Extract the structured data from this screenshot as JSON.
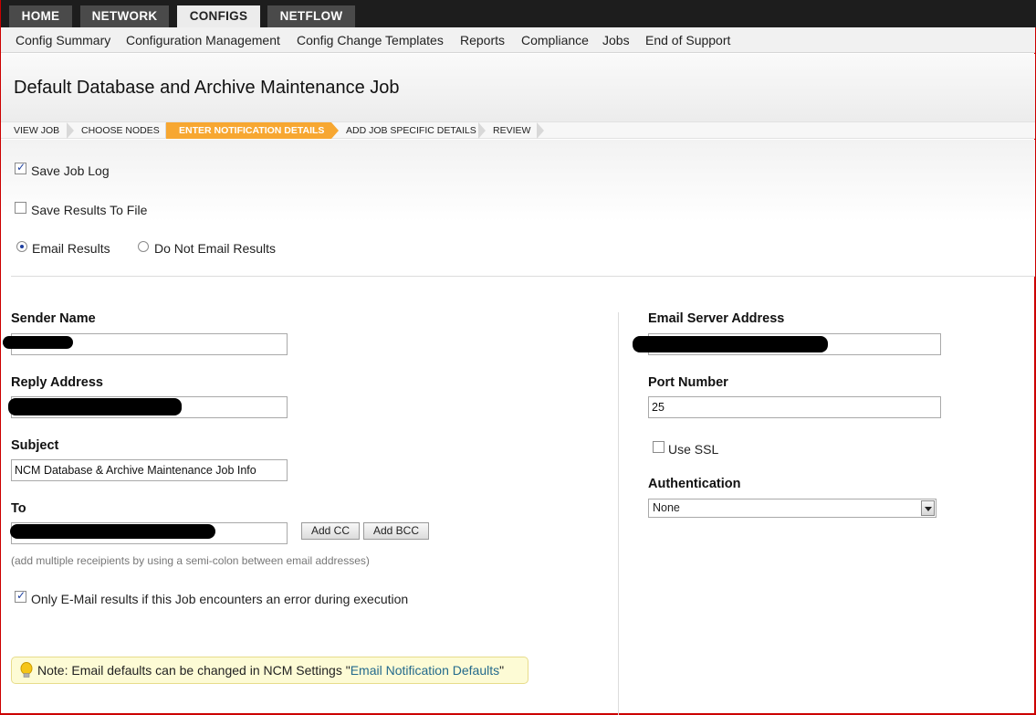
{
  "top_tabs": [
    {
      "label": "HOME"
    },
    {
      "label": "NETWORK"
    },
    {
      "label": "CONFIGS",
      "active": true
    },
    {
      "label": "NETFLOW"
    }
  ],
  "sub_nav": [
    "Config Summary",
    "Configuration Management",
    "Config Change Templates",
    "Reports",
    "Compliance",
    "Jobs",
    "End of Support"
  ],
  "page_title": "Default Database and Archive Maintenance Job",
  "wizard_steps": [
    {
      "label": "VIEW JOB"
    },
    {
      "label": "CHOOSE NODES"
    },
    {
      "label": "ENTER NOTIFICATION DETAILS",
      "active": true
    },
    {
      "label": "ADD JOB SPECIFIC DETAILS"
    },
    {
      "label": "REVIEW"
    }
  ],
  "options": {
    "save_job_log": {
      "label": "Save Job Log",
      "checked": true
    },
    "save_results_to_file": {
      "label": "Save Results To File",
      "checked": false
    },
    "email_results": {
      "label": "Email Results",
      "selected": true
    },
    "do_not_email_results": {
      "label": "Do Not Email Results",
      "selected": false
    }
  },
  "left_form": {
    "sender_name": {
      "label": "Sender Name",
      "value": ""
    },
    "reply_address": {
      "label": "Reply Address",
      "value": ""
    },
    "subject": {
      "label": "Subject",
      "value": "NCM Database & Archive Maintenance Job Info"
    },
    "to": {
      "label": "To",
      "value": ""
    },
    "add_cc_label": "Add CC",
    "add_bcc_label": "Add BCC",
    "to_hint": "(add multiple receipients by using a semi-colon between email addresses)",
    "only_on_error": {
      "label": "Only E-Mail results if this Job encounters an error during execution",
      "checked": true
    }
  },
  "right_form": {
    "email_server_address": {
      "label": "Email Server Address",
      "value": ""
    },
    "port_number": {
      "label": "Port Number",
      "value": "25"
    },
    "use_ssl": {
      "label": "Use SSL",
      "checked": false
    },
    "authentication": {
      "label": "Authentication",
      "value": "None"
    }
  },
  "note": {
    "prefix": "Note: Email defaults can be changed in NCM Settings \"",
    "link": "Email Notification Defaults",
    "suffix": "\""
  },
  "colors": {
    "active_step": "#f7a731",
    "top_bar": "#1d1d1d",
    "link": "#246a8c"
  }
}
